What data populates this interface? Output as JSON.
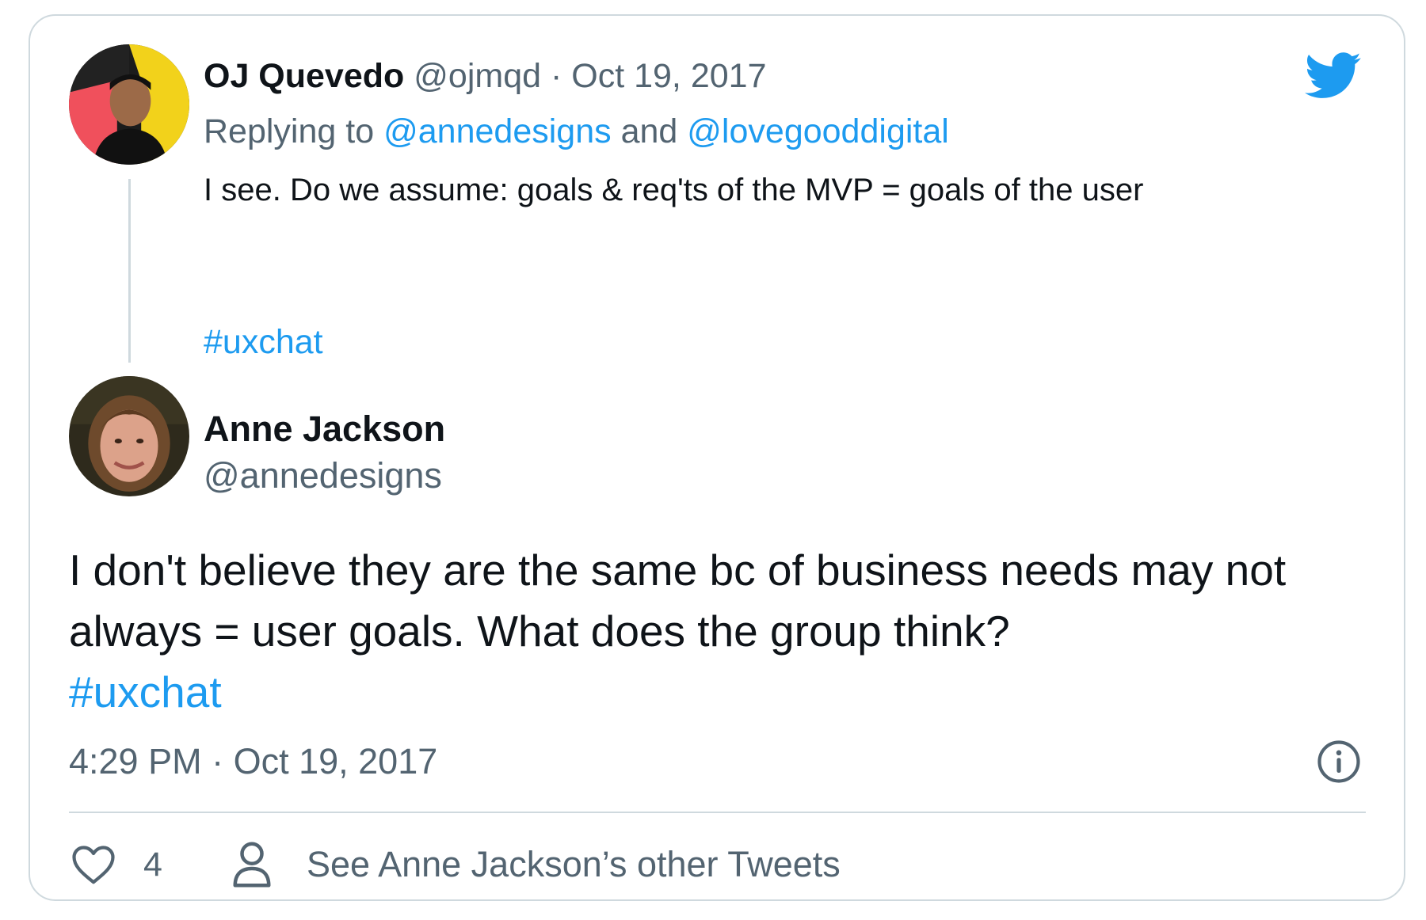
{
  "parent_tweet": {
    "author_name": "OJ Quevedo",
    "handle": "@ojmqd",
    "separator": "·",
    "date": "Oct 19, 2017",
    "replying_prefix": "Replying to",
    "replying_user_1": "@annedesigns",
    "replying_and": "and",
    "replying_user_2": "@lovegooddigital",
    "text": "I see. Do we assume: goals & req'ts of the MVP = goals of the user",
    "hashtag": "#uxchat"
  },
  "main_tweet": {
    "author_name": "Anne Jackson",
    "handle": "@annedesigns",
    "text": "I don't believe they are the same bc of business needs may not always = user goals. What does the group think?",
    "hashtag": "#uxchat",
    "timestamp": "4:29 PM · Oct 19, 2017",
    "like_count": "4",
    "see_other_tweets": "See Anne Jackson’s other Tweets"
  },
  "icons": {
    "brand": "twitter-bird-icon",
    "info": "info-icon",
    "like": "heart-icon",
    "profile": "person-icon"
  },
  "colors": {
    "link": "#1d9bf0",
    "text": "#0f1419",
    "muted": "#536471",
    "border": "#cfd9de"
  }
}
